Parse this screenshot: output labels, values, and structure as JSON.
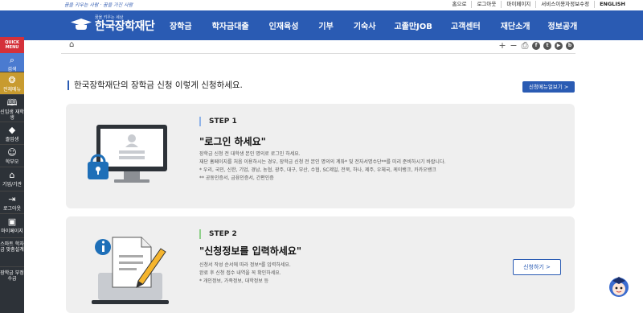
{
  "topbar": {
    "slogan": "꿈을 키우는 사람 · 꿈을 가진 사람",
    "links": [
      "홈으로",
      "로그아웃",
      "마이페이지",
      "서비스이용자정보수정",
      "ENGLISH"
    ]
  },
  "logo": {
    "sub": "꿈을 키우는 세상",
    "main": "한국장학재단"
  },
  "menu": [
    "장학금",
    "학자금대출",
    "인재육성",
    "기부",
    "기숙사",
    "고졸만JOB",
    "고객센터",
    "재단소개",
    "정보공개"
  ],
  "sidebar": {
    "quick": "QUICK MENU",
    "items": [
      {
        "label": "검색",
        "icon": "search-icon"
      },
      {
        "label": "전체메뉴",
        "icon": "compass-icon"
      },
      {
        "label": "신입생 재학생",
        "icon": "book-icon"
      },
      {
        "label": "졸업생",
        "icon": "graduation-cap-icon"
      },
      {
        "label": "학부모",
        "icon": "parents-icon"
      },
      {
        "label": "기업/기관",
        "icon": "building-icon"
      },
      {
        "label": "로그아웃",
        "icon": "logout-icon"
      },
      {
        "label": "마이페이지",
        "icon": "mypage-icon"
      },
      {
        "label": "스마트 학자금 맞춤설계",
        "icon": ""
      },
      {
        "label": "장학금 부정수급",
        "icon": ""
      }
    ]
  },
  "tools": [
    "+",
    "−"
  ],
  "page": {
    "heading": "한국장학재단의 장학금 신청 이렇게 신청하세요.",
    "guide_button": "신청메뉴얼보기 >"
  },
  "steps": [
    {
      "badge": "STEP 1",
      "title": "\"로그인 하세요\"",
      "desc": [
        "장학금 신청 전 대학생 본인 명의로 로그인 하세요.",
        "재단 홈페이지를 처음 이용하시는 경우, 장학금 신청 전 본인 명의의 계좌* 및 전자서명수단**를 미리 준비하시기 바랍니다.",
        "* 우리, 국민, 신한, 기업, 경남, 농협, 광주, 대구, 부산, 수협, SC제일, 전북, 하나, 제주, 우체국, 케이뱅크, 카카오뱅크",
        "** 공동인증서, 금융인증서, 간편인증"
      ]
    },
    {
      "badge": "STEP 2",
      "title": "\"신청정보를 입력하세요\"",
      "desc": [
        "신청서 작성 순서에 따라 정보*를 입력하세요.",
        "완료 후 신청 접수 내역을 꼭 확인하세요.",
        "* 개인정보, 가족정보, 대학정보 등"
      ],
      "button": "신청하기 >"
    }
  ],
  "colors": {
    "brand": "#2a5bb3",
    "quick": "#d4313a",
    "sidebar": "#2d3238"
  }
}
